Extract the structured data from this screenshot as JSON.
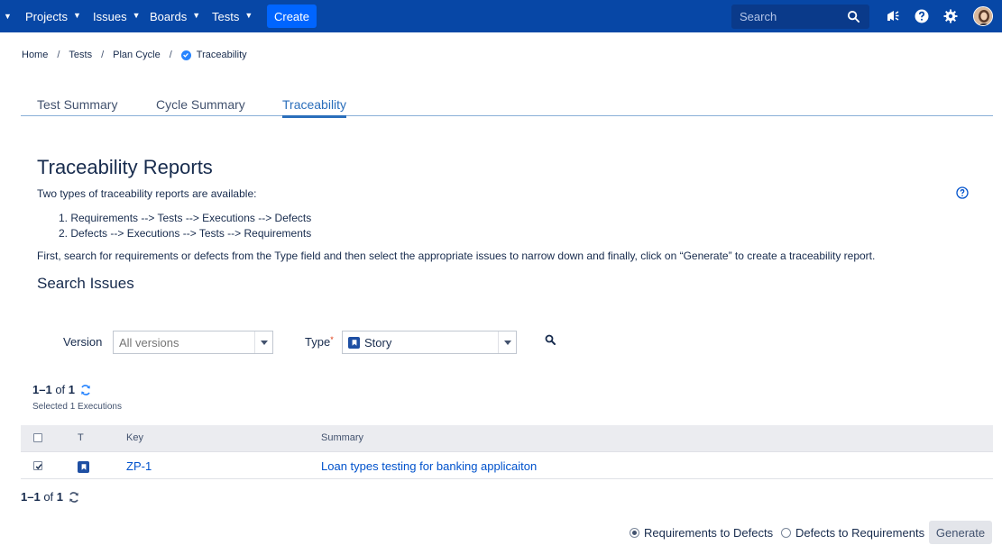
{
  "nav": {
    "items": [
      "Projects",
      "Issues",
      "Boards",
      "Tests"
    ],
    "create_label": "Create",
    "search_placeholder": "Search"
  },
  "breadcrumb": [
    "Home",
    "Tests",
    "Plan Cycle",
    "Traceability"
  ],
  "tabs": [
    "Test Summary",
    "Cycle Summary",
    "Traceability"
  ],
  "active_tab": "Traceability",
  "page": {
    "title": "Traceability Reports",
    "intro": "Two types of traceability reports are available:",
    "list": [
      "1. Requirements --> Tests --> Executions --> Defects",
      "2. Defects --> Executions --> Tests --> Requirements"
    ],
    "instruction": "First, search for requirements or defects from the Type field and then select the appropriate issues to narrow down and finally, click on “Generate” to create a traceability report.",
    "search_heading": "Search Issues"
  },
  "filters": {
    "version_label": "Version",
    "version_placeholder": "All versions",
    "type_label": "Type",
    "type_required_mark": "*",
    "type_value": "Story"
  },
  "results": {
    "count_range": "1–1",
    "count_of": "of",
    "count_total": "1",
    "selected_text": "Selected 1 Executions",
    "columns": [
      "T",
      "Key",
      "Summary"
    ],
    "rows": [
      {
        "checked": true,
        "type_icon": "story-icon",
        "key": "ZP-1",
        "summary": "Loan types testing for banking applicaiton"
      }
    ]
  },
  "report_options": {
    "option_1": "Requirements to Defects",
    "option_2": "Defects to Requirements",
    "selected": "Requirements to Defects",
    "generate_label": "Generate"
  },
  "colors": {
    "nav_bg": "#0747a6",
    "create_bg": "#0065ff",
    "link": "#0052cc",
    "tab_active": "#2a6ebb"
  }
}
